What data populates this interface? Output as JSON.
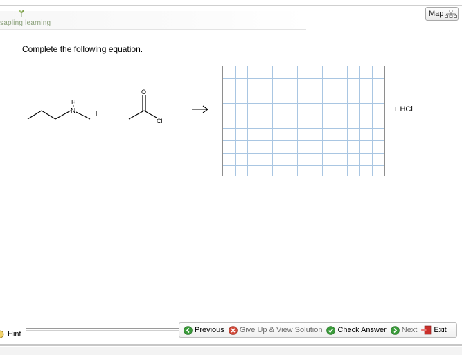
{
  "header": {
    "logo_text": "sapling learning",
    "map_label": "Map"
  },
  "question": {
    "prompt": "Complete the following equation.",
    "plus": "+",
    "arrow": "→",
    "product_extra": "+ HCl",
    "atoms": {
      "hydrogen": "H",
      "nitrogen": "N",
      "oxygen": "O",
      "chlorine": "Cl"
    }
  },
  "footer": {
    "hint_label": "Hint",
    "nav": [
      {
        "label": "Previous"
      },
      {
        "label": "Give Up & View Solution"
      },
      {
        "label": "Check Answer"
      },
      {
        "label": "Next"
      },
      {
        "label": "Exit"
      }
    ]
  },
  "colors": {
    "grid_line": "#a9c6e2",
    "logo_green": "#8aa07a",
    "previous_icon": "#3a9b3a",
    "give_up_icon": "#d24a3a",
    "check_icon": "#3a9b3a",
    "next_icon": "#3a9b3a",
    "exit_icon": "#c9302c"
  }
}
